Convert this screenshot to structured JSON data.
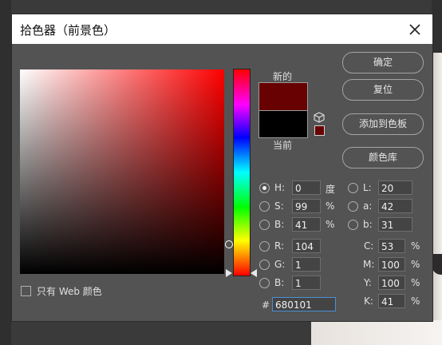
{
  "title": "拾色器（前景色）",
  "swatches": {
    "new_label": "新的",
    "current_label": "当前",
    "new_color": "#680101",
    "current_color": "#000000"
  },
  "buttons": {
    "ok": "确定",
    "reset": "复位",
    "add_to_swatches": "添加到色板",
    "color_libraries": "颜色库"
  },
  "hsb": {
    "h": {
      "label": "H:",
      "value": "0",
      "unit": "度"
    },
    "s": {
      "label": "S:",
      "value": "99",
      "unit": "%"
    },
    "b": {
      "label": "B:",
      "value": "41",
      "unit": "%"
    }
  },
  "rgb": {
    "r": {
      "label": "R:",
      "value": "104"
    },
    "g": {
      "label": "G:",
      "value": "1"
    },
    "b": {
      "label": "B:",
      "value": "1"
    }
  },
  "lab": {
    "l": {
      "label": "L:",
      "value": "20"
    },
    "a": {
      "label": "a:",
      "value": "42"
    },
    "b": {
      "label": "b:",
      "value": "31"
    }
  },
  "cmyk": {
    "c": {
      "label": "C:",
      "value": "53",
      "unit": "%"
    },
    "m": {
      "label": "M:",
      "value": "100",
      "unit": "%"
    },
    "y": {
      "label": "Y:",
      "value": "100",
      "unit": "%"
    },
    "k": {
      "label": "K:",
      "value": "41",
      "unit": "%"
    }
  },
  "hex": {
    "label": "#",
    "value": "680101"
  },
  "web_only": {
    "label": "只有 Web 颜色",
    "checked": false
  },
  "selected_mode": "H"
}
